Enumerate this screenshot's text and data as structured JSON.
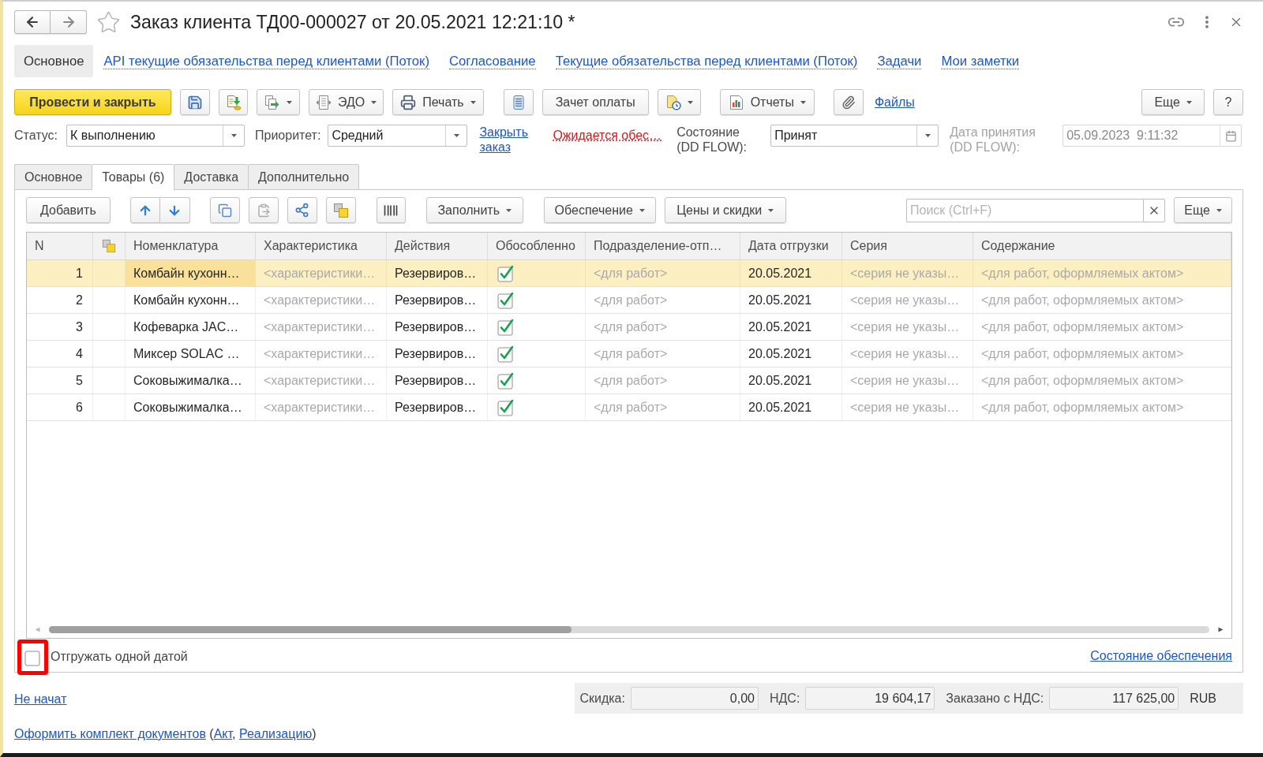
{
  "window": {
    "title": "Заказ клиента ТД00-000027 от 20.05.2021 12:21:10 *",
    "favorite": false
  },
  "nav_tabs": [
    {
      "label": "Основное",
      "selected": true
    },
    {
      "label": "API текущие обязательства перед клиентами (Поток)",
      "selected": false
    },
    {
      "label": "Согласование",
      "selected": false
    },
    {
      "label": "Текущие обязательства перед клиентами (Поток)",
      "selected": false
    },
    {
      "label": "Задачи",
      "selected": false
    },
    {
      "label": "Мои заметки",
      "selected": false
    }
  ],
  "command_bar": {
    "post_and_close": "Провести и закрыть",
    "edo": "ЭДО",
    "print": "Печать",
    "payment_offset": "Зачет оплаты",
    "reports": "Отчеты",
    "files": "Файлы",
    "more": "Еще",
    "help": "?"
  },
  "header_fields": {
    "status": {
      "label": "Статус:",
      "value": "К выполнению"
    },
    "priority": {
      "label": "Приоритет:",
      "value": "Средний"
    },
    "close_order_link": "Закрыть заказ",
    "provision_warning_link": "Ожидается обес…",
    "flow_state": {
      "label": "Состояние (DD FLOW):",
      "value": "Принят"
    },
    "accepted_date": {
      "label": "Дата принятия (DD FLOW):",
      "value": "05.09.2023  9:11:32",
      "disabled": true
    }
  },
  "tabs": [
    {
      "label": "Основное",
      "selected": false
    },
    {
      "label": "Товары (6)",
      "selected": true
    },
    {
      "label": "Доставка",
      "selected": false
    },
    {
      "label": "Дополнительно",
      "selected": false
    }
  ],
  "table_toolbar": {
    "add": "Добавить",
    "paste": {
      "disabled": true
    },
    "fill": "Заполнить",
    "provision": "Обеспечение",
    "prices": "Цены и скидки",
    "search": {
      "placeholder": "Поиск (Ctrl+F)"
    },
    "more": "Еще"
  },
  "table": {
    "columns": [
      {
        "kind": "text",
        "label": "N"
      },
      {
        "kind": "icon"
      },
      {
        "kind": "text",
        "label": "Номенклатура"
      },
      {
        "kind": "text",
        "label": "Характеристика"
      },
      {
        "kind": "text",
        "label": "Действия"
      },
      {
        "kind": "text",
        "label": "Обособленно"
      },
      {
        "kind": "text",
        "label": "Подразделение-отп…"
      },
      {
        "kind": "text",
        "label": "Дата отгрузки"
      },
      {
        "kind": "text",
        "label": "Серия"
      },
      {
        "kind": "text",
        "label": "Содержание"
      }
    ],
    "rows": [
      {
        "selected": true,
        "n": "1",
        "item": "Комбайн кухонн…",
        "characteristic": "<характеристики…",
        "action": "Резервиров…",
        "separate": true,
        "department": "<для работ>",
        "ship_date": "20.05.2021",
        "series": "<серия не указы…",
        "content": "<для работ, оформляемых актом>"
      },
      {
        "selected": false,
        "n": "2",
        "item": "Комбайн кухонн…",
        "characteristic": "<характеристики…",
        "action": "Резервиров…",
        "separate": true,
        "department": "<для работ>",
        "ship_date": "20.05.2021",
        "series": "<серия не указы…",
        "content": "<для работ, оформляемых актом>"
      },
      {
        "selected": false,
        "n": "3",
        "item": "Кофеварка JAC…",
        "characteristic": "<характеристики…",
        "action": "Резервиров…",
        "separate": true,
        "department": "<для работ>",
        "ship_date": "20.05.2021",
        "series": "<серия не указы…",
        "content": "<для работ, оформляемых актом>"
      },
      {
        "selected": false,
        "n": "4",
        "item": "Миксер SOLAC …",
        "characteristic": "<характеристики…",
        "action": "Резервиров…",
        "separate": true,
        "department": "<для работ>",
        "ship_date": "20.05.2021",
        "series": "<серия не указы…",
        "content": "<для работ, оформляемых актом>"
      },
      {
        "selected": false,
        "n": "5",
        "item": "Соковыжималка…",
        "characteristic": "<характеристики…",
        "action": "Резервиров…",
        "separate": true,
        "department": "<для работ>",
        "ship_date": "20.05.2021",
        "series": "<серия не указы…",
        "content": "<для работ, оформляемых актом>"
      },
      {
        "selected": false,
        "n": "6",
        "item": "Соковыжималка…",
        "characteristic": "<характеристики…",
        "action": "Резервиров…",
        "separate": true,
        "department": "<для работ>",
        "ship_date": "20.05.2021",
        "series": "<серия не указы…",
        "content": "<для работ, оформляемых актом>"
      }
    ]
  },
  "ship_one_date": {
    "label": "Отгружать одной датой",
    "checked": false,
    "highlighted": true
  },
  "provision_status_link": "Состояние обеспечения",
  "footer": {
    "status_link": "Не начат",
    "totals": [
      {
        "label": "Скидка:",
        "value": "0,00"
      },
      {
        "label": "НДС:",
        "value": "19 604,17"
      },
      {
        "label": "Заказано с НДС:",
        "value": "117 625,00"
      }
    ],
    "currency": "RUB",
    "documents": [
      {
        "kind": "link",
        "text": "Оформить комплект документов"
      },
      {
        "kind": "text",
        "text": " ("
      },
      {
        "kind": "link",
        "text": "Акт"
      },
      {
        "kind": "text",
        "text": ", "
      },
      {
        "kind": "link",
        "text": "Реализацию"
      },
      {
        "kind": "text",
        "text": ")"
      }
    ]
  }
}
